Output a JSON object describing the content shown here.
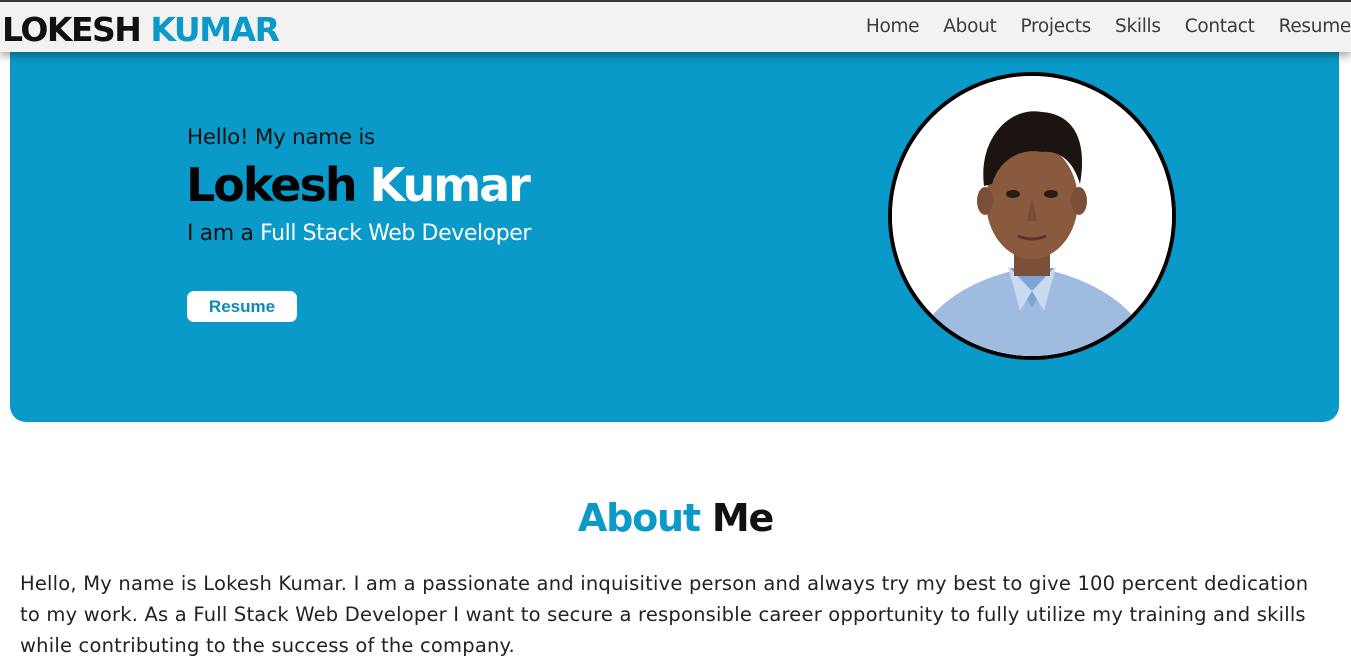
{
  "navbar": {
    "logo_first": "LOKESH",
    "logo_second": "KUMAR",
    "links": [
      "Home",
      "About",
      "Projects",
      "Skills",
      "Contact",
      "Resume"
    ]
  },
  "hero": {
    "greeting": "Hello! My name is",
    "first_name": "Lokesh",
    "last_name": "Kumar",
    "role_prefix": "I am a",
    "role": "Full Stack Web Developer",
    "resume_button": "Resume"
  },
  "about": {
    "title_highlight": "About",
    "title_rest": "Me",
    "paragraph": "Hello, My name is Lokesh Kumar. I am a passionate and inquisitive person and always try my best to give 100 percent dedication to my work. As a Full Stack Web Developer I want to secure a responsible career opportunity to fully utilize my training and skills while contributing to the success of the company."
  },
  "colors": {
    "accent": "#0a9ac9",
    "navbar_bg": "#f3f1f1",
    "hero_bg": "#0a9ac9",
    "text_dark": "#111111"
  }
}
